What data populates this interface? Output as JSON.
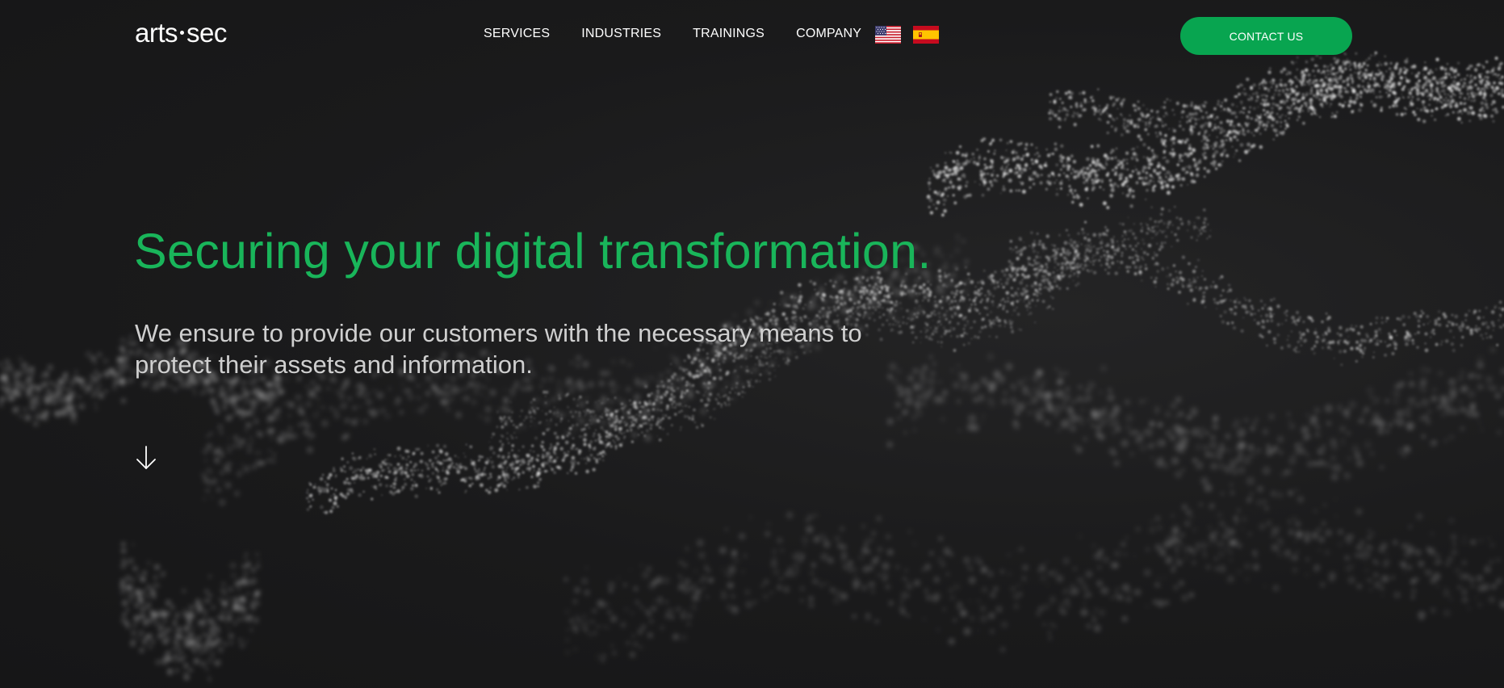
{
  "brand": {
    "name_left": "arts",
    "name_right": "sec"
  },
  "nav": {
    "items": [
      {
        "label": "SERVICES"
      },
      {
        "label": "INDUSTRIES"
      },
      {
        "label": "TRAININGS"
      },
      {
        "label": "COMPANY"
      }
    ],
    "languages": [
      {
        "icon": "us-flag-icon"
      },
      {
        "icon": "spain-flag-icon"
      }
    ]
  },
  "header": {
    "contact_label": "CONTACT US"
  },
  "hero": {
    "title": "Securing your digital transformation.",
    "subtitle_line1": "We ensure to provide our customers with the necessary means to",
    "subtitle_line2": "protect their assets and information.",
    "scroll_icon": "arrow-down-icon"
  },
  "colors": {
    "background": "#1b1b1c",
    "accent": "#19b55a",
    "button": "#08a550",
    "text": "#ffffff",
    "subtext": "#cfcfcf"
  }
}
